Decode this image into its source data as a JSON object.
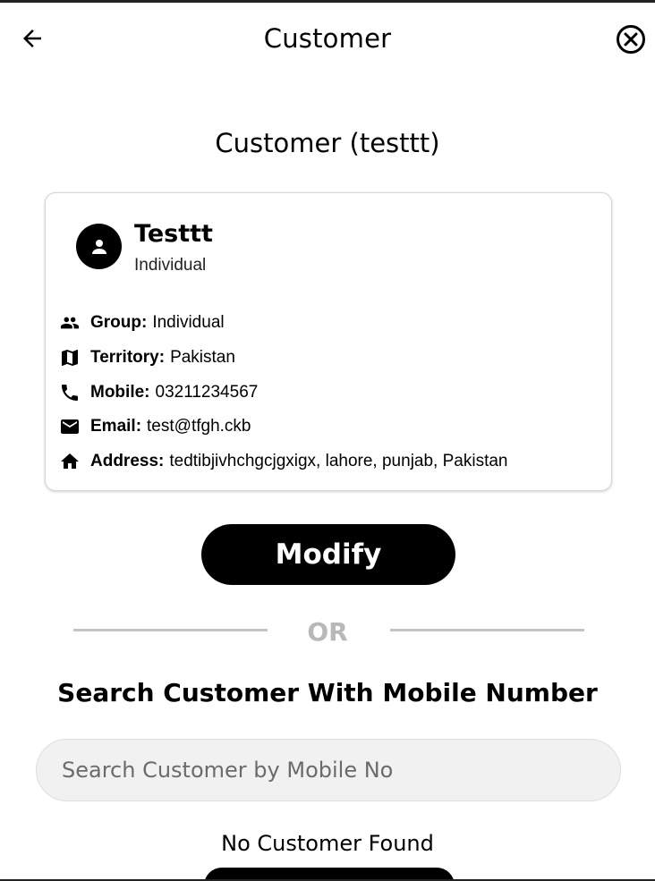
{
  "header": {
    "title": "Customer",
    "back_icon": "arrow-left-icon",
    "close_icon": "close-circle-icon"
  },
  "section_title": "Customer (testtt)",
  "customer_card": {
    "avatar_icon": "person-icon",
    "name": "Testtt",
    "type": "Individual",
    "rows": [
      {
        "icon": "group-icon",
        "label": "Group:",
        "value": "Individual"
      },
      {
        "icon": "map-icon",
        "label": "Territory:",
        "value": "Pakistan"
      },
      {
        "icon": "phone-icon",
        "label": "Mobile:",
        "value": "03211234567"
      },
      {
        "icon": "email-icon",
        "label": "Email:",
        "value": "test@tfgh.ckb"
      },
      {
        "icon": "home-icon",
        "label": "Address:",
        "value": "tedtibjivhchgcjgxigx, lahore, punjab, Pakistan"
      }
    ]
  },
  "modify_button": "Modify",
  "divider_text": "OR",
  "search": {
    "title": "Search Customer With Mobile Number",
    "placeholder": "Search Customer by Mobile No",
    "value": ""
  },
  "no_result_text": "No Customer Found",
  "colors": {
    "primary": "#000000",
    "divider": "#c4c4c4",
    "input_bg": "#f1f1f1"
  }
}
